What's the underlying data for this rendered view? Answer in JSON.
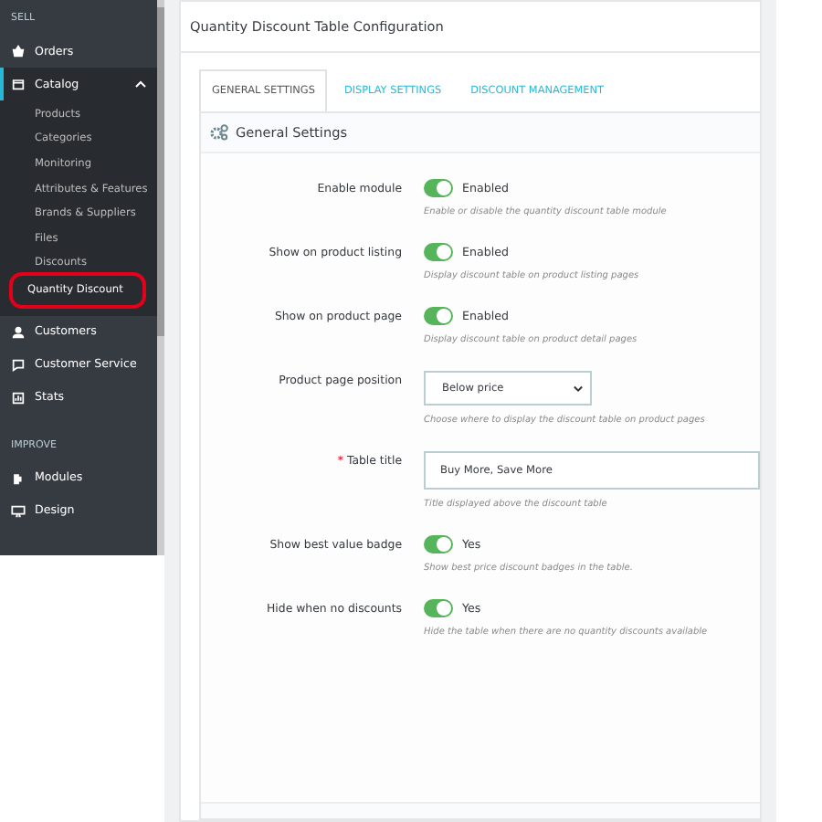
{
  "sidebar": {
    "sections": [
      {
        "title": "SELL",
        "items": [
          {
            "label": "Orders",
            "selected": false
          },
          {
            "label": "Catalog",
            "selected": true,
            "expanded": true,
            "children": [
              {
                "label": "Products",
                "selected": false,
                "circled": false
              },
              {
                "label": "Categories",
                "selected": false,
                "circled": false
              },
              {
                "label": "Monitoring",
                "selected": false,
                "circled": false
              },
              {
                "label": "Attributes & Features",
                "selected": false,
                "circled": false
              },
              {
                "label": "Brands & Suppliers",
                "selected": false,
                "circled": false
              },
              {
                "label": "Files",
                "selected": false,
                "circled": false
              },
              {
                "label": "Discounts",
                "selected": false,
                "circled": false
              },
              {
                "label": "Quantity Discount",
                "selected": true,
                "circled": true
              }
            ]
          },
          {
            "label": "Customers",
            "selected": false
          },
          {
            "label": "Customer Service",
            "selected": false
          },
          {
            "label": "Stats",
            "selected": false
          }
        ]
      },
      {
        "title": "IMPROVE",
        "items": [
          {
            "label": "Modules",
            "selected": false
          },
          {
            "label": "Design",
            "selected": false
          }
        ]
      }
    ]
  },
  "panel": {
    "title": "Quantity Discount Table Configuration",
    "tabs": [
      {
        "label": "GENERAL SETTINGS",
        "selected": true
      },
      {
        "label": "DISPLAY SETTINGS",
        "selected": false
      },
      {
        "label": "DISCOUNT MANAGEMENT",
        "selected": false
      }
    ],
    "section_title": "General Settings",
    "fields": [
      {
        "kind": "toggle",
        "label": "Enable module",
        "on": true,
        "value": "Enabled",
        "help": "Enable or disable the quantity discount table module"
      },
      {
        "kind": "toggle",
        "label": "Show on product listing",
        "on": true,
        "value": "Enabled",
        "help": "Display discount table on product listing pages"
      },
      {
        "kind": "toggle",
        "label": "Show on product page",
        "on": true,
        "value": "Enabled",
        "help": "Display discount table on product detail pages"
      },
      {
        "kind": "select",
        "label": "Product page position",
        "value": "Below price",
        "help": "Choose where to display the discount table on product pages"
      },
      {
        "kind": "text",
        "label": "Table title",
        "required": true,
        "required_mark": "*",
        "value": "Buy More, Save More",
        "help": "Title displayed above the discount table"
      },
      {
        "kind": "toggle",
        "label": "Show best value badge",
        "on": true,
        "value": "Yes",
        "help": "Show best price discount badges in the table."
      },
      {
        "kind": "toggle",
        "label": "Hide when no discounts",
        "on": true,
        "value": "Yes",
        "help": "Hide the table when there are no quantity discounts available"
      }
    ]
  }
}
